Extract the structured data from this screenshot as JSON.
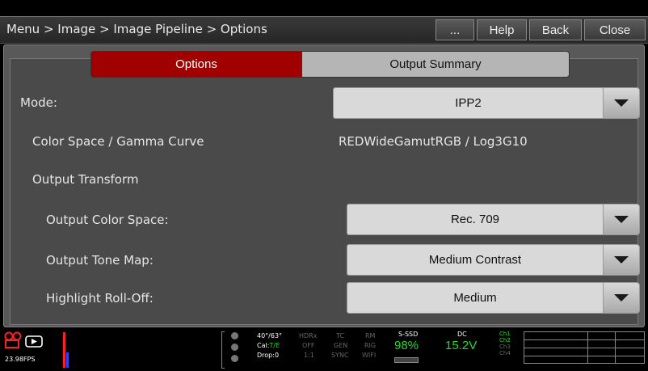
{
  "header": {
    "breadcrumb": "Menu > Image > Image Pipeline > Options",
    "buttons": {
      "more": "...",
      "help": "Help",
      "back": "Back",
      "close": "Close"
    }
  },
  "tabs": [
    {
      "label": "Options",
      "active": true
    },
    {
      "label": "Output Summary",
      "active": false
    }
  ],
  "settings": {
    "mode": {
      "label": "Mode:",
      "value": "IPP2"
    },
    "color_space": {
      "label": "Color Space / Gamma Curve",
      "value": "REDWideGamutRGB / Log3G10"
    },
    "output_transform": {
      "label": "Output Transform"
    },
    "output_color_space": {
      "label": "Output Color Space:",
      "value": "Rec. 709"
    },
    "output_tone_map": {
      "label": "Output Tone Map:",
      "value": "Medium Contrast"
    },
    "highlight_rolloff": {
      "label": "Highlight Roll-Off:",
      "value": "Medium"
    }
  },
  "status_bar": {
    "fps": "23.98FPS",
    "temp": "40°/63°",
    "cal": "Cal:",
    "cal_value": "T/E",
    "drop": "Drop:0",
    "col1": [
      "HDRx",
      "OFF",
      "1:1"
    ],
    "col2": [
      "TC",
      "GEN",
      "SYNC"
    ],
    "col3": [
      "RM",
      "RIG",
      "WIFI"
    ],
    "media_label": "S-SSD",
    "media_value": "98%",
    "power_label": "DC",
    "power_value": "15.2V",
    "channels": [
      "Ch1",
      "Ch2",
      "Ch3",
      "Ch4"
    ],
    "colors": {
      "green": "#22dd22",
      "red": "#ff2020",
      "accent": "#a00000"
    }
  }
}
